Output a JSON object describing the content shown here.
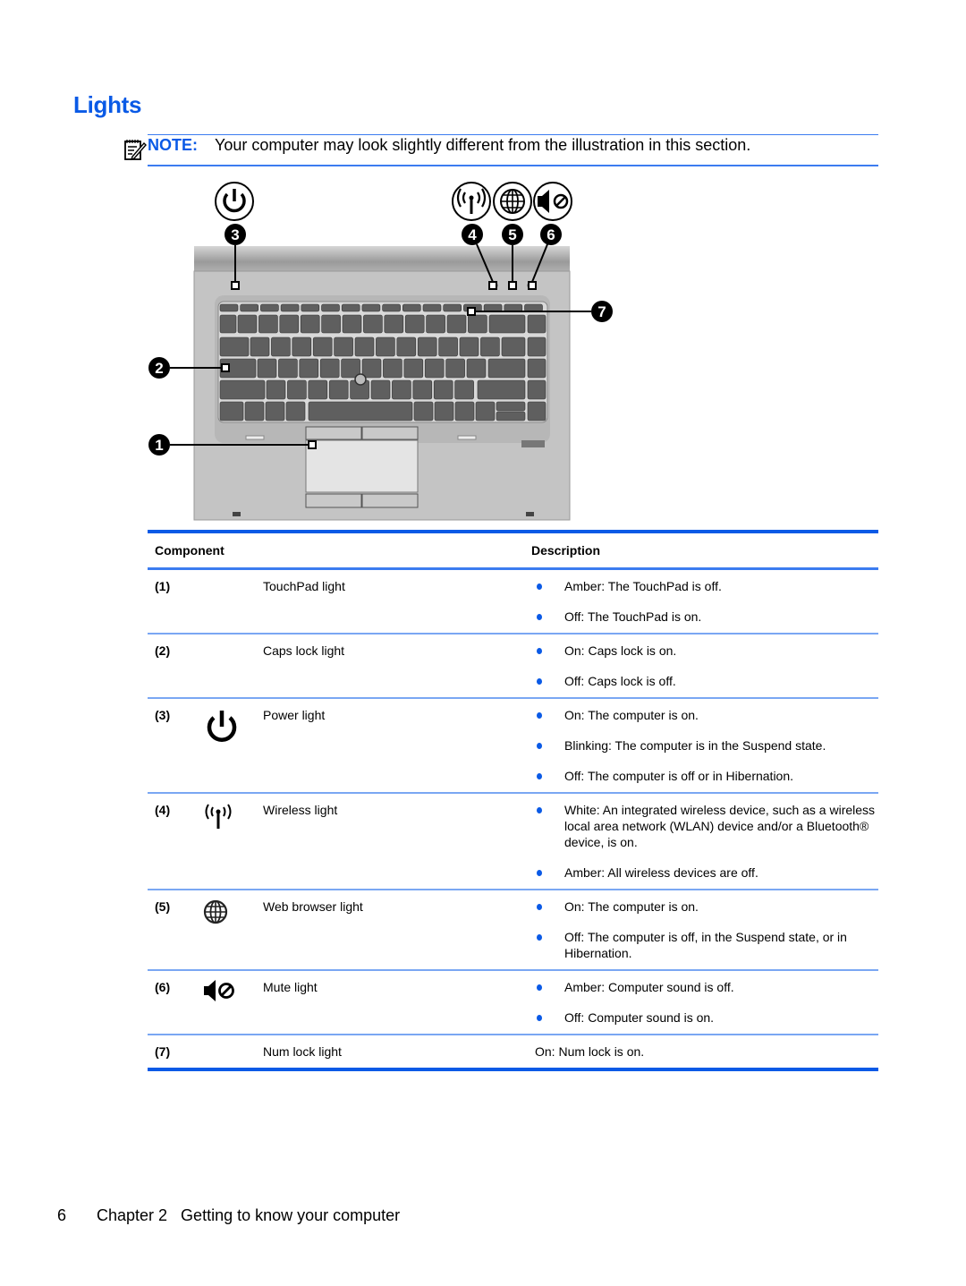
{
  "page": {
    "title": "Lights",
    "note": {
      "icon": "note-pencil-icon",
      "label": "NOTE:",
      "text": "Your computer may look slightly different from the illustration in this section."
    },
    "figure": {
      "callout_icons": [
        "power-icon",
        "wireless-icon",
        "web-browser-globe-icon",
        "mute-icon"
      ],
      "callouts": [
        "1",
        "2",
        "3",
        "4",
        "5",
        "6",
        "7"
      ]
    },
    "table": {
      "headers": {
        "component": "Component",
        "description": "Description"
      },
      "rows": [
        {
          "num": "(1)",
          "icon": "",
          "name": "TouchPad light",
          "bullets": [
            "Amber: The TouchPad is off.",
            "Off: The TouchPad is on."
          ]
        },
        {
          "num": "(2)",
          "icon": "",
          "name": "Caps lock light",
          "bullets": [
            "On: Caps lock is on.",
            "Off: Caps lock is off."
          ]
        },
        {
          "num": "(3)",
          "icon": "power-icon",
          "name": "Power light",
          "bullets": [
            "On: The computer is on.",
            "Blinking: The computer is in the Suspend state.",
            "Off: The computer is off or in Hibernation."
          ]
        },
        {
          "num": "(4)",
          "icon": "wireless-icon",
          "name": "Wireless light",
          "bullets": [
            "White: An integrated wireless device, such as a wireless local area network (WLAN) device and/or a Bluetooth® device, is on.",
            "Amber: All wireless devices are off."
          ]
        },
        {
          "num": "(5)",
          "icon": "web-browser-globe-icon",
          "name": "Web browser light",
          "bullets": [
            "On: The computer is on.",
            "Off: The computer is off, in the Suspend state, or in Hibernation."
          ]
        },
        {
          "num": "(6)",
          "icon": "mute-icon",
          "name": "Mute light",
          "bullets": [
            "Amber: Computer sound is off.",
            "Off: Computer sound is on."
          ]
        },
        {
          "num": "(7)",
          "icon": "",
          "name": "Num lock light",
          "plain": "On: Num lock is on."
        }
      ]
    },
    "footer": {
      "page_number": "6",
      "chapter": "Chapter 2   Getting to know your computer"
    }
  }
}
